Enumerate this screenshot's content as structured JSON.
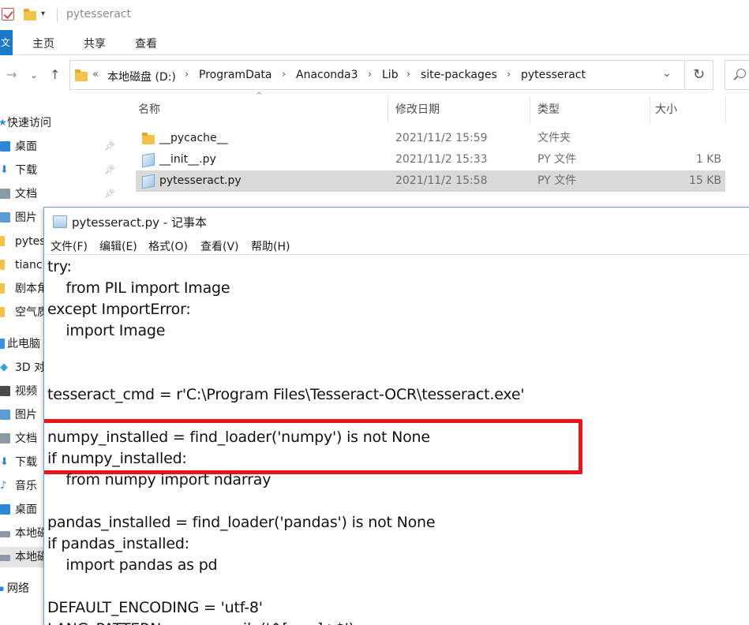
{
  "explorer": {
    "title": "pytesseract",
    "ribbon_tabs": [
      "文件",
      "主页",
      "共享",
      "查看"
    ],
    "breadcrumb_prefix": "«",
    "breadcrumbs": [
      "本地磁盘 (D:)",
      "ProgramData",
      "Anaconda3",
      "Lib",
      "site-packages",
      "pytesseract"
    ],
    "columns": {
      "name": "名称",
      "modified": "修改日期",
      "type": "类型",
      "size": "大小"
    },
    "files": [
      {
        "name": "__pycache__",
        "modified": "2021/11/2 15:59",
        "type": "文件夹",
        "size": "",
        "icon": "folder-icon"
      },
      {
        "name": "__init__.py",
        "modified": "2021/11/2 15:33",
        "type": "PY 文件",
        "size": "1 KB",
        "icon": "python-file-icon"
      },
      {
        "name": "pytesseract.py",
        "modified": "2021/11/2 15:58",
        "type": "PY 文件",
        "size": "15 KB",
        "icon": "python-file-icon",
        "selected": true
      }
    ],
    "nav_pane": [
      {
        "label": "快速访问",
        "icon": "star-icon"
      },
      {
        "label": "桌面",
        "icon": "desktop-icon",
        "pinned": true
      },
      {
        "label": "下载",
        "icon": "download-icon",
        "pinned": true
      },
      {
        "label": "文档",
        "icon": "documents-icon",
        "pinned": true
      },
      {
        "label": "图片",
        "icon": "pictures-icon"
      },
      {
        "label": "pytes",
        "icon": "folder-icon"
      },
      {
        "label": "tianc",
        "icon": "folder-icon"
      },
      {
        "label": "剧本角",
        "icon": "folder-icon"
      },
      {
        "label": "空气质",
        "icon": "folder-icon"
      },
      {
        "label": "此电脑",
        "icon": "computer-icon"
      },
      {
        "label": "3D 对",
        "icon": "3d-objects-icon"
      },
      {
        "label": "视频",
        "icon": "videos-icon"
      },
      {
        "label": "图片",
        "icon": "pictures-icon"
      },
      {
        "label": "文档",
        "icon": "documents-icon"
      },
      {
        "label": "下载",
        "icon": "download-icon"
      },
      {
        "label": "音乐",
        "icon": "music-icon"
      },
      {
        "label": "桌面",
        "icon": "desktop-icon"
      },
      {
        "label": "本地磁",
        "icon": "drive-icon"
      },
      {
        "label": "本地磁",
        "icon": "drive-icon",
        "selected": true
      },
      {
        "label": "网络",
        "icon": "network-icon"
      }
    ]
  },
  "notepad": {
    "title": "pytesseract.py - 记事本",
    "menu": [
      "文件(F)",
      "编辑(E)",
      "格式(O)",
      "查看(V)",
      "帮助(H)"
    ],
    "lines": [
      "try:",
      "    from PIL import Image",
      "except ImportError:",
      "    import Image",
      "",
      "",
      "tesseract_cmd = r'C:\\Program Files\\Tesseract-OCR\\tesseract.exe'",
      "",
      "numpy_installed = find_loader('numpy') is not None",
      "if numpy_installed:",
      "    from numpy import ndarray",
      "",
      "pandas_installed = find_loader('pandas') is not None",
      "if pandas_installed:",
      "    import pandas as pd",
      "",
      "DEFAULT_ENCODING = 'utf-8'",
      "LANG_PATTERN = re.compile('^[a-z_]+$')"
    ],
    "highlight_color": "#e8151b"
  }
}
